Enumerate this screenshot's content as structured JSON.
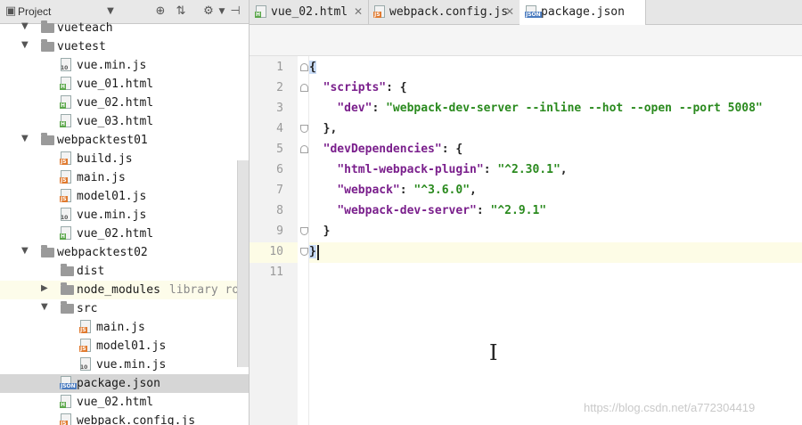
{
  "project_panel": {
    "title": "Project",
    "tree": [
      {
        "label": "vueteach",
        "type": "folder",
        "indent": 1,
        "state": "cut"
      },
      {
        "label": "vuetest",
        "type": "folder",
        "indent": 1,
        "state": "open"
      },
      {
        "label": "vue.min.js",
        "type": "binary",
        "indent": 2
      },
      {
        "label": "vue_01.html",
        "type": "html",
        "indent": 2
      },
      {
        "label": "vue_02.html",
        "type": "html",
        "indent": 2
      },
      {
        "label": "vue_03.html",
        "type": "html",
        "indent": 2
      },
      {
        "label": "webpacktest01",
        "type": "folder",
        "indent": 1,
        "state": "open"
      },
      {
        "label": "build.js",
        "type": "js",
        "indent": 2
      },
      {
        "label": "main.js",
        "type": "js",
        "indent": 2
      },
      {
        "label": "model01.js",
        "type": "js",
        "indent": 2
      },
      {
        "label": "vue.min.js",
        "type": "binary",
        "indent": 2
      },
      {
        "label": "vue_02.html",
        "type": "html",
        "indent": 2
      },
      {
        "label": "webpacktest02",
        "type": "folder",
        "indent": 1,
        "state": "open"
      },
      {
        "label": "dist",
        "type": "folder",
        "indent": 2,
        "state": "none"
      },
      {
        "label": "node_modules",
        "type": "folder",
        "indent": 2,
        "state": "closed",
        "note": "library root"
      },
      {
        "label": "src",
        "type": "folder",
        "indent": 2,
        "state": "open"
      },
      {
        "label": "main.js",
        "type": "js",
        "indent": 3
      },
      {
        "label": "model01.js",
        "type": "js",
        "indent": 3
      },
      {
        "label": "vue.min.js",
        "type": "binary",
        "indent": 3
      },
      {
        "label": "package.json",
        "type": "json",
        "indent": 2,
        "selected": true
      },
      {
        "label": "vue_02.html",
        "type": "html",
        "indent": 2
      },
      {
        "label": "webpack.config.js",
        "type": "js",
        "indent": 2
      }
    ]
  },
  "tabs": [
    {
      "label": "vue_02.html",
      "type": "html",
      "active": false
    },
    {
      "label": "webpack.config.js",
      "type": "js",
      "active": false
    },
    {
      "label": "package.json",
      "type": "json",
      "active": true
    }
  ],
  "editor": {
    "line_numbers": [
      "1",
      "2",
      "3",
      "4",
      "5",
      "6",
      "7",
      "8",
      "9",
      "10",
      "11"
    ],
    "lines": [
      [
        {
          "t": "{",
          "c": "p"
        }
      ],
      [
        {
          "t": "  ",
          "c": "p"
        },
        {
          "t": "\"scripts\"",
          "c": "k"
        },
        {
          "t": ": {",
          "c": "p"
        }
      ],
      [
        {
          "t": "    ",
          "c": "p"
        },
        {
          "t": "\"dev\"",
          "c": "k"
        },
        {
          "t": ": ",
          "c": "p"
        },
        {
          "t": "\"webpack-dev-server --inline --hot --open --port 5008\"",
          "c": "s"
        }
      ],
      [
        {
          "t": "  },",
          "c": "p"
        }
      ],
      [
        {
          "t": "  ",
          "c": "p"
        },
        {
          "t": "\"devDependencies\"",
          "c": "k"
        },
        {
          "t": ": {",
          "c": "p"
        }
      ],
      [
        {
          "t": "    ",
          "c": "p"
        },
        {
          "t": "\"html-webpack-plugin\"",
          "c": "k"
        },
        {
          "t": ": ",
          "c": "p"
        },
        {
          "t": "\"^2.30.1\"",
          "c": "s"
        },
        {
          "t": ",",
          "c": "p"
        }
      ],
      [
        {
          "t": "    ",
          "c": "p"
        },
        {
          "t": "\"webpack\"",
          "c": "k"
        },
        {
          "t": ": ",
          "c": "p"
        },
        {
          "t": "\"^3.6.0\"",
          "c": "s"
        },
        {
          "t": ",",
          "c": "p"
        }
      ],
      [
        {
          "t": "    ",
          "c": "p"
        },
        {
          "t": "\"webpack-dev-server\"",
          "c": "k"
        },
        {
          "t": ": ",
          "c": "p"
        },
        {
          "t": "\"^2.9.1\"",
          "c": "s"
        }
      ],
      [
        {
          "t": "  }",
          "c": "p"
        }
      ],
      [
        {
          "t": "}",
          "c": "p"
        }
      ],
      []
    ],
    "current_line": "10"
  },
  "watermark": "https://blog.csdn.net/a772304419",
  "colors": {
    "key": "#7a1f8c",
    "string": "#2a8a1e",
    "selection": "#d6d6d6"
  }
}
